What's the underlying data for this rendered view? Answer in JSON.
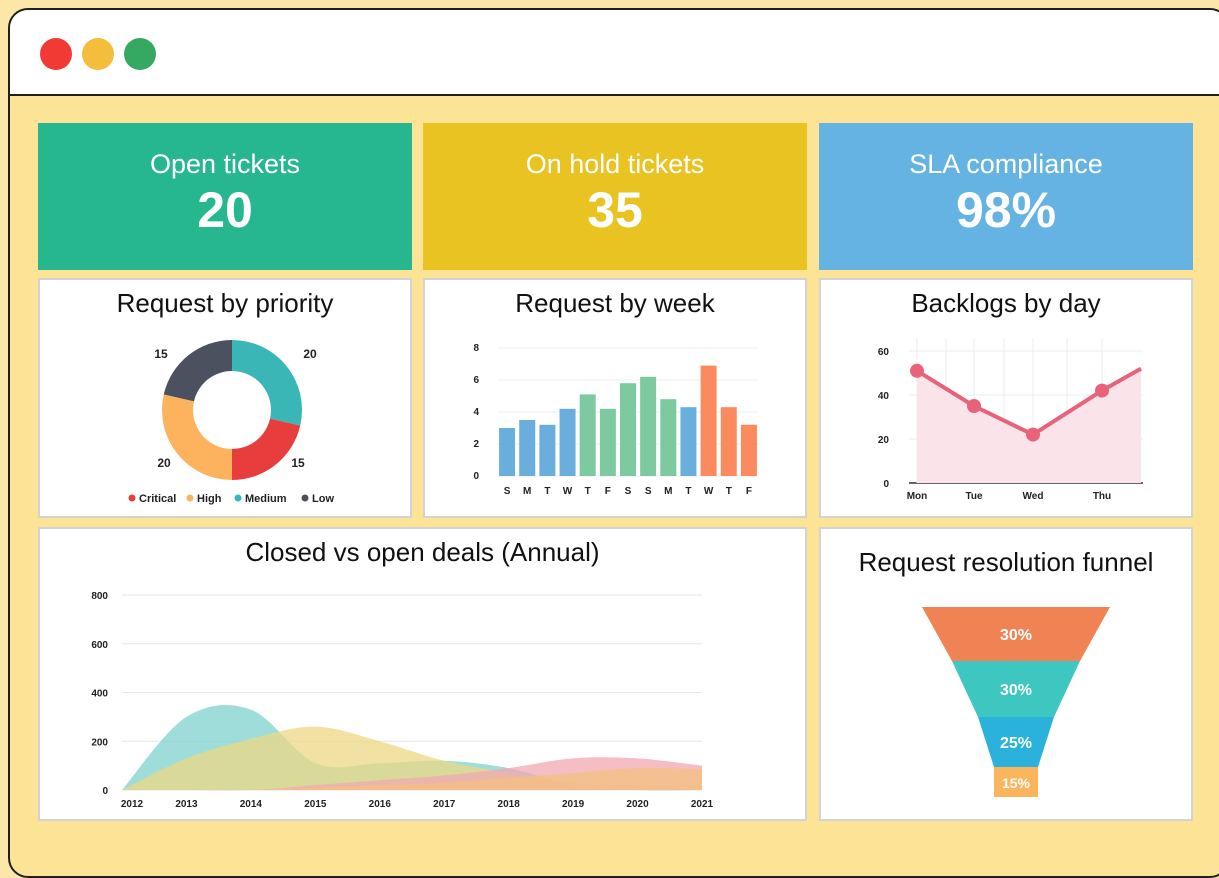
{
  "window_controls": [
    "close",
    "minimize",
    "maximize"
  ],
  "kpis": {
    "open": {
      "label": "Open tickets",
      "value": "20",
      "color": "#27b78e"
    },
    "hold": {
      "label": "On hold tickets",
      "value": "35",
      "color": "#e8c322"
    },
    "sla": {
      "label": "SLA compliance",
      "value": "98%",
      "color": "#64b3e2"
    }
  },
  "priority": {
    "title": "Request by priority",
    "chart_data": {
      "type": "pie",
      "title": "Request by priority",
      "labels": [
        "Medium",
        "Critical",
        "High",
        "Low"
      ],
      "values": [
        20,
        15,
        20,
        15
      ],
      "colors": [
        "#3bb6b6",
        "#e83d3d",
        "#fdb35e",
        "#4c5160"
      ]
    },
    "legend": [
      {
        "label": "Critical",
        "color": "#e83d3d"
      },
      {
        "label": "High",
        "color": "#fdb35e"
      },
      {
        "label": "Medium",
        "color": "#3bb6b6"
      },
      {
        "label": "Low",
        "color": "#4c5160"
      }
    ]
  },
  "weekly": {
    "title": "Request by week",
    "chart_data": {
      "type": "bar",
      "title": "Request by week",
      "categories": [
        "S",
        "M",
        "T",
        "W",
        "T",
        "F",
        "S",
        "S",
        "M",
        "T",
        "W",
        "T",
        "F"
      ],
      "values": [
        3.0,
        3.5,
        3.2,
        4.2,
        5.1,
        4.2,
        5.8,
        6.2,
        4.8,
        4.3,
        6.9,
        4.3,
        3.2
      ],
      "colors": [
        "#69aedc",
        "#69aedc",
        "#69aedc",
        "#69aedc",
        "#7dcaa0",
        "#7dcaa0",
        "#7dcaa0",
        "#7dcaa0",
        "#7dcaa0",
        "#69aedc",
        "#fb8a5e",
        "#fb8a5e",
        "#fb8a5e"
      ],
      "yticks": [
        0,
        2,
        4,
        6,
        8
      ],
      "ylim": [
        0,
        8
      ]
    }
  },
  "backlogs": {
    "title": "Backlogs by day",
    "chart_data": {
      "type": "line",
      "title": "Backlogs by day",
      "x": [
        "Mon",
        "",
        "Tue",
        "",
        "Wed",
        "",
        "Thu",
        ""
      ],
      "values": [
        51,
        35,
        22,
        42
      ],
      "categories": [
        "Mon",
        "Tue",
        "Wed",
        "Thu"
      ],
      "yticks": [
        0,
        20,
        40,
        60
      ],
      "ylim": [
        0,
        65
      ],
      "color": "#e8637a"
    }
  },
  "deals": {
    "title": "Closed vs open deals (Annual)",
    "chart_data": {
      "type": "area",
      "title": "Closed vs open deals (Annual)",
      "x": [
        "2012",
        "2013",
        "2014",
        "2015",
        "2016",
        "2017",
        "2018",
        "2019",
        "2020",
        "2021"
      ],
      "yticks": [
        0,
        200,
        400,
        600,
        800
      ],
      "ylim": [
        0,
        800
      ],
      "series": [
        {
          "values": [
            0,
            300,
            330,
            110,
            110,
            120,
            90,
            20,
            0,
            0
          ],
          "color": "#7fd1cf"
        },
        {
          "values": [
            0,
            130,
            210,
            260,
            200,
            120,
            70,
            30,
            20,
            20
          ],
          "color": "#ecd784"
        },
        {
          "values": [
            0,
            0,
            0,
            20,
            40,
            60,
            90,
            130,
            130,
            100
          ],
          "color": "#f2a8b1"
        },
        {
          "values": [
            0,
            0,
            0,
            10,
            20,
            30,
            50,
            70,
            90,
            85
          ],
          "color": "#f4c07f"
        }
      ]
    }
  },
  "funnel": {
    "title": "Request resolution funnel",
    "chart_data": {
      "type": "funnel",
      "title": "Request resolution funnel",
      "labels": [
        "30%",
        "30%",
        "25%",
        "15%"
      ],
      "values": [
        30,
        30,
        25,
        15
      ],
      "colors": [
        "#ef8354",
        "#3ec6c0",
        "#2bb2dc",
        "#fbb55c"
      ]
    }
  }
}
